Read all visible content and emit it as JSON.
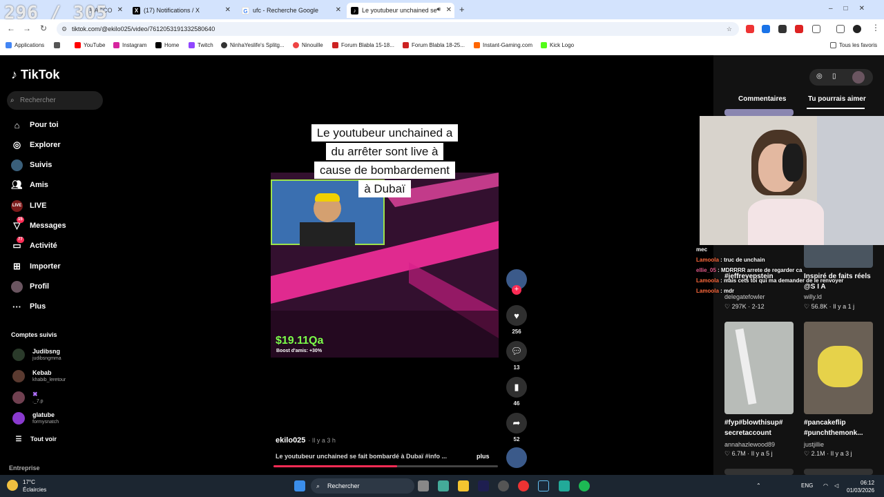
{
  "overlay_counter": "296 / 305",
  "tabs": [
    {
      "label": "FN/R",
      "icon": "tiktok-icon"
    },
    {
      "label": "(17) Notifications / X",
      "icon": "x-icon"
    },
    {
      "label": "ufc - Recherche Google",
      "icon": "google-icon"
    },
    {
      "label": "Le youtubeur unchained se",
      "icon": "tiktok-icon"
    }
  ],
  "tab_partial": "RACCO",
  "url": "tiktok.com/@ekilo025/video/7612053191332580640",
  "bookmarks": [
    "Applications",
    "YouTube",
    "Instagram",
    "Home",
    "Twitch",
    "NinhaYeslife's Splitg...",
    "Ninouille",
    "Forum Blabla 15-18...",
    "Forum Blabla 18-25...",
    "Instant-Gaming.com",
    "Kick Logo"
  ],
  "bookmarks_right": "Tous les favoris",
  "tiktok": {
    "logo": "TikTok",
    "search_placeholder": "Rechercher",
    "nav": [
      {
        "label": "Pour toi",
        "icon": "home-icon"
      },
      {
        "label": "Explorer",
        "icon": "compass-icon"
      },
      {
        "label": "Suivis",
        "icon": "following-icon"
      },
      {
        "label": "Amis",
        "icon": "friends-icon"
      },
      {
        "label": "LIVE",
        "icon": "live-icon"
      },
      {
        "label": "Messages",
        "icon": "messages-icon",
        "badge": "15"
      },
      {
        "label": "Activité",
        "icon": "activity-icon",
        "badge": "77"
      },
      {
        "label": "Importer",
        "icon": "upload-icon"
      },
      {
        "label": "Profil",
        "icon": "profile-icon"
      },
      {
        "label": "Plus",
        "icon": "more-icon"
      }
    ],
    "followed_title": "Comptes suivis",
    "followed": [
      {
        "name": "Judibsng",
        "handle": "judibsngmma"
      },
      {
        "name": "Kebab",
        "handle": "khabib_leretour"
      },
      {
        "name": "✖",
        "handle": "._7.p"
      },
      {
        "name": "glatube",
        "handle": "formysnatch"
      }
    ],
    "see_all": "Tout voir",
    "footer": "Entreprise"
  },
  "video": {
    "overlay_lines": [
      "Le youtubeur unchained a",
      "du arrêter sont live à",
      "cause de bombardement",
      "à Dubaï"
    ],
    "money": "$19.11Qa",
    "boost": "Boost d'amis: +30%",
    "author": "ekilo025",
    "time": "· Il y a 3 h",
    "description": "Le youtubeur unchained se fait bombardé à Dubaï #info ...",
    "more": "plus",
    "progress": 0.55,
    "likes": "256",
    "comments": "13",
    "saves": "46",
    "shares": "52"
  },
  "right": {
    "tab_comments": "Commentaires",
    "tab_suggest": "Tu pourrais aimer",
    "cards": [
      {
        "caption": "#jeffreyepstein",
        "user": "delegatefowler",
        "likes": "297K",
        "date": "2-12"
      },
      {
        "caption": "Inspiré de faits réels @S I A",
        "user": "willy.ld",
        "likes": "56.8K",
        "date": "Il y a 1 j"
      },
      {
        "caption": "#fyp#blowthisup# secretaccount",
        "user": "annahazlewood89",
        "likes": "6.7M",
        "date": "Il y a 5 j"
      },
      {
        "caption": "#pancakeflip #punchthemonk...",
        "user": "justjillie",
        "likes": "2.1M",
        "date": "Il y a 3 j"
      }
    ]
  },
  "chat": [
    {
      "user": "",
      "msg": "mec"
    },
    {
      "user": "Lamoola",
      "msg": "truc de unchain"
    },
    {
      "user": "ellie_05",
      "msg": "MDRRRR arrete de regarder ca"
    },
    {
      "user": "Lamoola",
      "msg": "mais cets toi qui ma demander de le renvoyer"
    },
    {
      "user": "Lamoola",
      "msg": "mdr"
    }
  ],
  "taskbar": {
    "temp": "17°C",
    "weather": "Éclaircies",
    "search": "Rechercher",
    "lang": "ENG",
    "time": "06:12",
    "date": "01/03/2026"
  }
}
